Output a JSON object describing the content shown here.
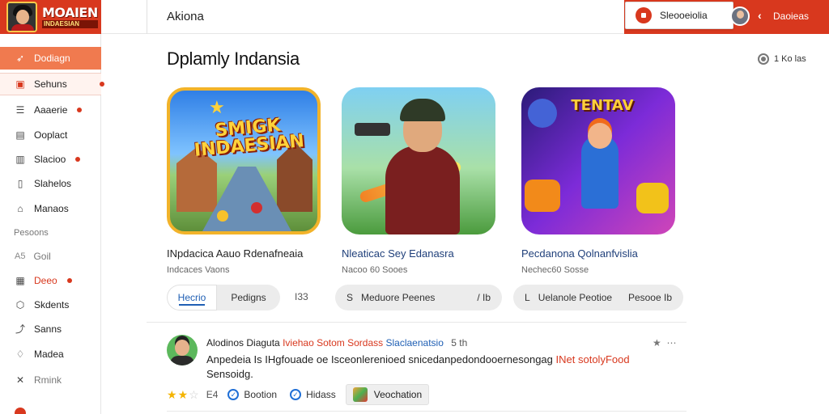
{
  "header": {
    "logo_line1": "MOAIEN",
    "logo_line2": "INDAESIAN",
    "title": "Akiona",
    "status_chip": "Sleooeiolia",
    "user_name": "Daoieas"
  },
  "sidebar": {
    "items": [
      {
        "label": "Dodiagn",
        "icon": "rocket-icon"
      },
      {
        "label": "Sehuns",
        "icon": "grid-icon"
      },
      {
        "label": "Aaaerie",
        "icon": "list-icon"
      },
      {
        "label": "Ooplact",
        "icon": "document-icon"
      },
      {
        "label": "Slacioo",
        "icon": "box-icon"
      },
      {
        "label": "Slahelos",
        "icon": "document-icon"
      },
      {
        "label": "Manaos",
        "icon": "home-icon"
      }
    ],
    "section_label": "Pesoons",
    "items2": [
      {
        "label": "Goil",
        "prefix": "A5"
      },
      {
        "label": "Deeo",
        "icon": "calendar-icon"
      },
      {
        "label": "Skdents",
        "icon": "shield-icon"
      },
      {
        "label": "Sanns",
        "icon": "link-icon"
      },
      {
        "label": "Madea",
        "icon": "bell-icon"
      },
      {
        "label": "Rmink",
        "icon": "close-icon"
      }
    ]
  },
  "main": {
    "page_title": "Dplamly Indansia",
    "filter_count": "1 Ko las",
    "cards": [
      {
        "thumb_text": "SMIGK INDAESIAN",
        "title": "INpdacica Aauo Rdenafneaia",
        "meta": "Indcaces Vaons"
      },
      {
        "title": "Nleaticac Sey Edanasra",
        "meta": "Nacoo 60 Sooes"
      },
      {
        "thumb_text": "TENTAV",
        "title": "Pecdanona Qolnanfvislia",
        "meta": "Nechec60 Sosse"
      }
    ],
    "tabs": {
      "active": "Hecrio",
      "inactive": "Pedigns",
      "icon_label": "I33"
    },
    "pill2": {
      "left": "S",
      "mid": "Meduore Peenes",
      "right": "/ Ib"
    },
    "pill3": {
      "left": "L",
      "mid": "Uelanole Peotioe",
      "right": "Pesooe Ib"
    }
  },
  "comment": {
    "author": "Alodinos Diaguta",
    "tag1": "Iviehao Sotom Sordass",
    "tag2": "Slaclaenatsio",
    "meta": "5  th",
    "body": "Anpedeia Is IHgfouade oe Isceonlerenioed snicedanpedondooernesongag",
    "body_red": "INet sotolyFood",
    "body2": "Sensoidg.",
    "rating_value": 2,
    "rating_max": 3,
    "rating_label": "E4",
    "chip1": "Bootion",
    "chip2": "Hidass",
    "chip3": "Veochation"
  },
  "colors": {
    "brand": "#d8381e",
    "accent": "#f07a4f",
    "link": "#1f5fb4"
  }
}
